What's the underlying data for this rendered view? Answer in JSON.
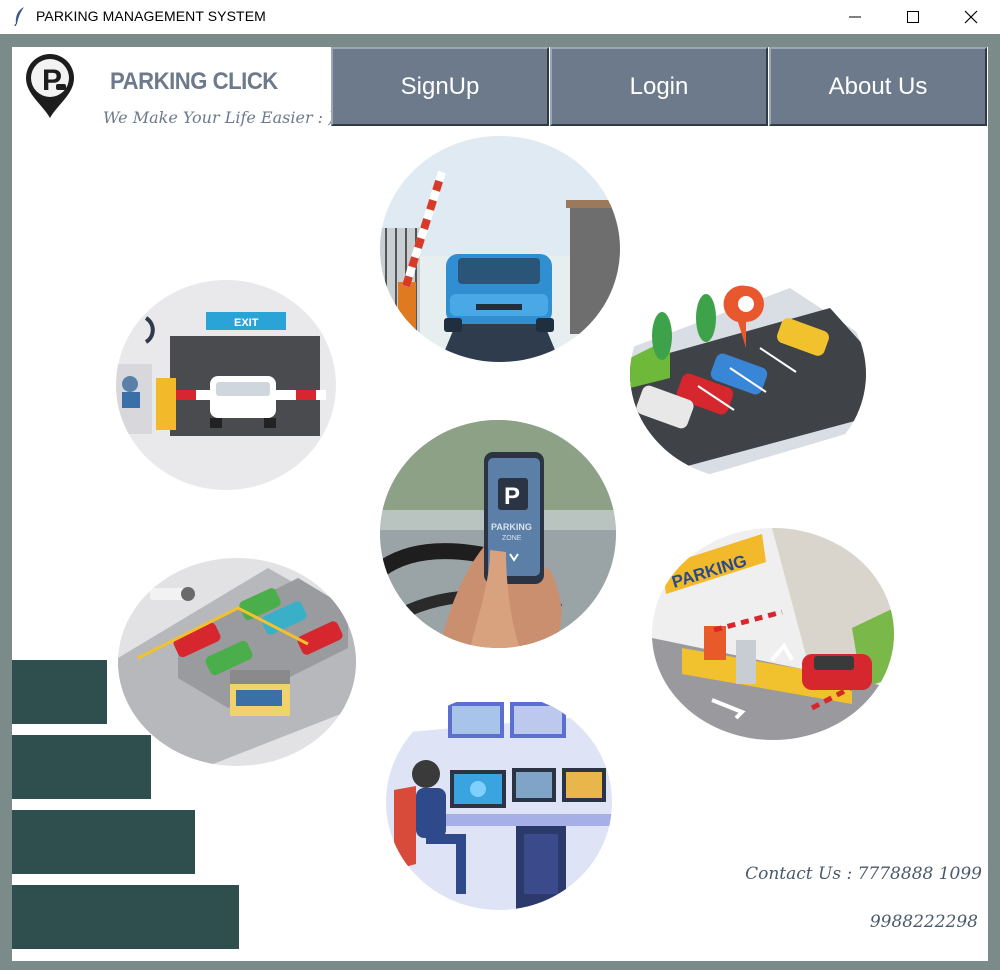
{
  "window": {
    "title": "PARKING MANAGEMENT SYSTEM",
    "app_icon": "feather-icon",
    "controls": {
      "minimize": "minimize-icon",
      "maximize": "maximize-icon",
      "close": "close-icon"
    }
  },
  "header": {
    "logo_icon": "parking-pin-icon",
    "logo_letter": "P",
    "brand": "PARKING CLICK",
    "tagline": "We Make Your Life Easier : )"
  },
  "nav": {
    "signup_label": "SignUp",
    "login_label": "Login",
    "about_label": "About Us"
  },
  "illustrations": {
    "gate_exit_sign": "EXIT",
    "phone_letter": "P",
    "phone_text_1": "PARKING",
    "phone_text_2": "ZONE",
    "entrance_sign": "PARKING"
  },
  "contact": {
    "line1": "Contact Us : 7778888 1099",
    "line2": "9988222298"
  },
  "colors": {
    "frame": "#7b8b89",
    "nav_bg": "#6c7a8c",
    "sidebar_bars": "#2f4f4f",
    "brand_text": "#6c7a8c"
  }
}
